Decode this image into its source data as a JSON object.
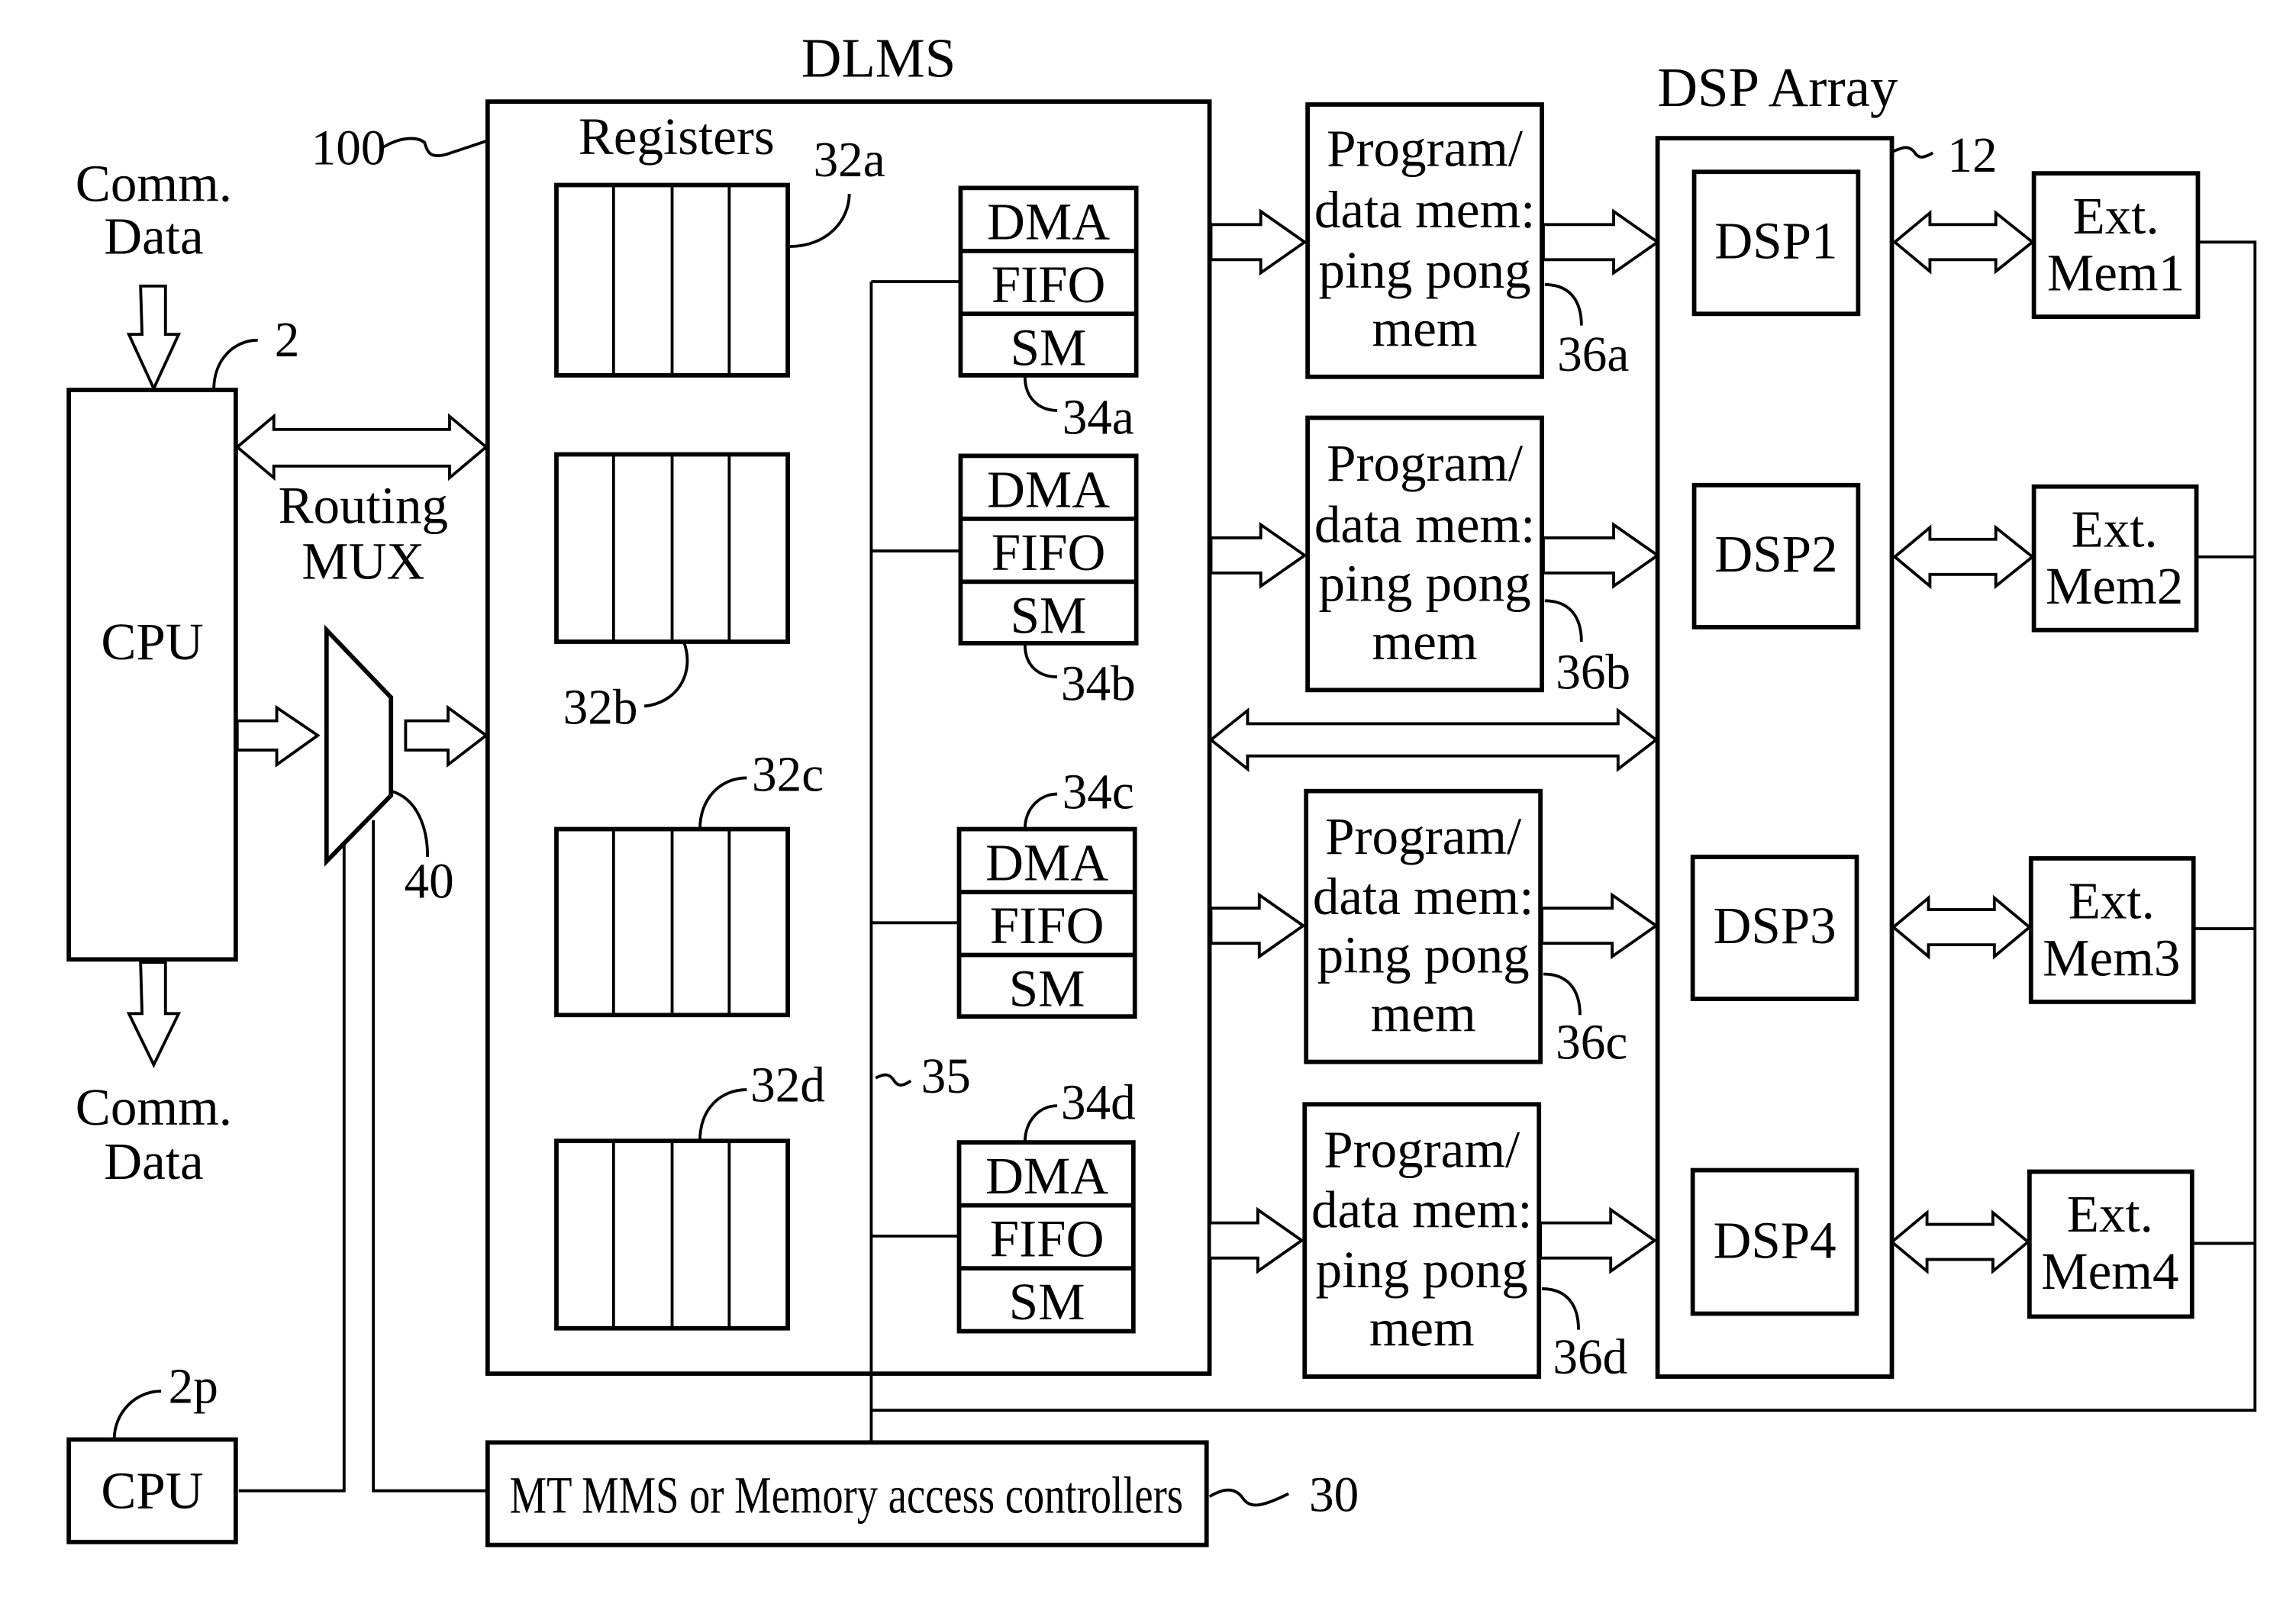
{
  "titles": {
    "dlms": "DLMS",
    "dsp_array": "DSP Array",
    "registers": "Registers"
  },
  "inputs": {
    "comm_in": [
      "Comm.",
      "Data"
    ],
    "comm_out": [
      "Comm.",
      "Data"
    ],
    "routing_mux": [
      "Routing",
      "MUX"
    ]
  },
  "cpu_main": {
    "label": "CPU",
    "ref": "2"
  },
  "cpu_p": {
    "label": "CPU",
    "ref": "2p"
  },
  "refs": {
    "dlms": "100",
    "dsp_array": "12",
    "mux": "40",
    "bus": "35",
    "controller": "30"
  },
  "register_banks": [
    {
      "ref": "32a"
    },
    {
      "ref": "32b"
    },
    {
      "ref": "32c"
    },
    {
      "ref": "32d"
    }
  ],
  "dma_units": [
    {
      "ref": "34a",
      "rows": [
        "DMA",
        "FIFO",
        "SM"
      ]
    },
    {
      "ref": "34b",
      "rows": [
        "DMA",
        "FIFO",
        "SM"
      ]
    },
    {
      "ref": "34c",
      "rows": [
        "DMA",
        "FIFO",
        "SM"
      ]
    },
    {
      "ref": "34d",
      "rows": [
        "DMA",
        "FIFO",
        "SM"
      ]
    }
  ],
  "pingpong_mems": [
    {
      "ref": "36a",
      "lines": [
        "Program/",
        "data mem:",
        "ping pong",
        "mem"
      ]
    },
    {
      "ref": "36b",
      "lines": [
        "Program/",
        "data mem:",
        "ping pong",
        "mem"
      ]
    },
    {
      "ref": "36c",
      "lines": [
        "Program/",
        "data mem:",
        "ping pong",
        "mem"
      ]
    },
    {
      "ref": "36d",
      "lines": [
        "Program/",
        "data mem:",
        "ping pong",
        "mem"
      ]
    }
  ],
  "dsps": [
    {
      "label": "DSP1"
    },
    {
      "label": "DSP2"
    },
    {
      "label": "DSP3"
    },
    {
      "label": "DSP4"
    }
  ],
  "ext_mems": [
    {
      "lines": [
        "Ext.",
        "Mem1"
      ]
    },
    {
      "lines": [
        "Ext.",
        "Mem2"
      ]
    },
    {
      "lines": [
        "Ext.",
        "Mem3"
      ]
    },
    {
      "lines": [
        "Ext.",
        "Mem4"
      ]
    }
  ],
  "controller": {
    "label": "MT MMS or Memory access controllers"
  }
}
